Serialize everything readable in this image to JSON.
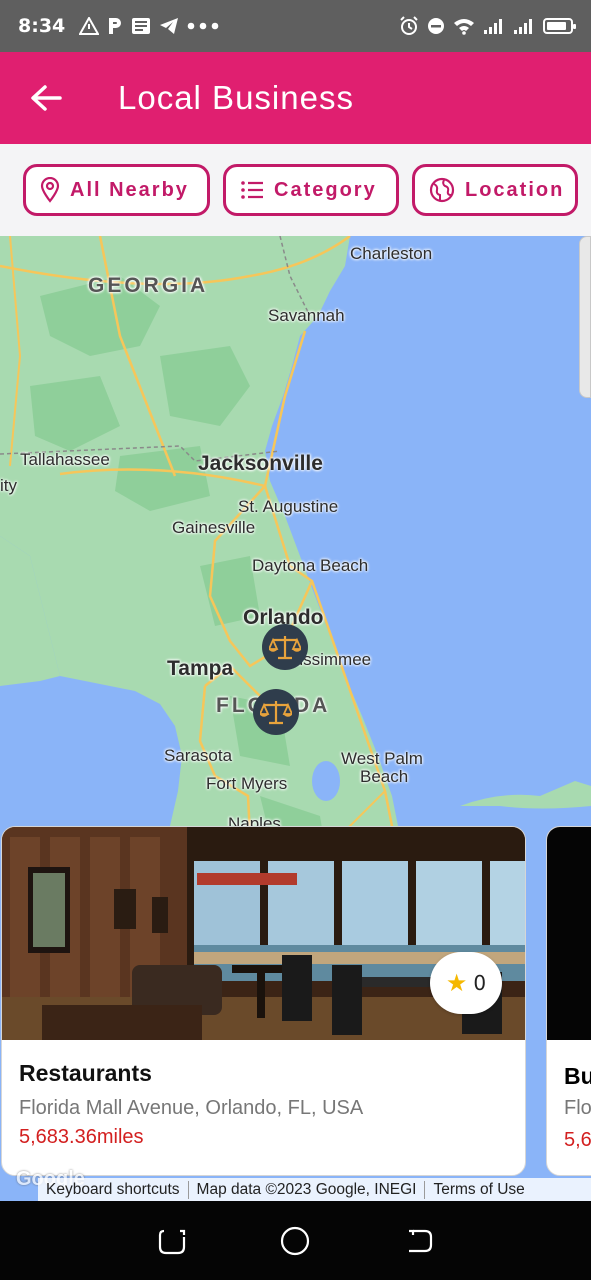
{
  "status_bar": {
    "time": "8:34",
    "left_icons": [
      "warning-icon",
      "p-icon",
      "news-icon",
      "telegram-icon",
      "more-dots-icon"
    ],
    "right_icons": [
      "alarm-icon",
      "dnd-icon",
      "wifi-icon",
      "signal-icon",
      "signal-icon",
      "battery-icon"
    ],
    "battery_level": 0.85
  },
  "app_bar": {
    "title": "Local Business",
    "back_icon": "arrow-left-icon"
  },
  "filters": [
    {
      "label": "All Nearby",
      "icon": "map-pin-icon"
    },
    {
      "label": "Category",
      "icon": "list-icon"
    },
    {
      "label": "Location",
      "icon": "globe-icon"
    }
  ],
  "map": {
    "labels": {
      "georgia": "GEORGIA",
      "charleston": "Charleston",
      "savannah": "Savannah",
      "tallahassee": "Tallahassee",
      "jacksonville": "Jacksonville",
      "st_augustine": "St. Augustine",
      "gainesville": "Gainesville",
      "daytona": "Daytona Beach",
      "orlando": "Orlando",
      "kissimmee": "Kissimmee",
      "tampa": "Tampa",
      "florida": "FLORIDA",
      "sarasota": "Sarasota",
      "fort_myers": "Fort Myers",
      "west_palm": "West Palm",
      "west_palm_2": "Beach",
      "naples": "Naples",
      "ity": "ity"
    },
    "marker_icon": "scales-icon",
    "attribution": {
      "keyboard": "Keyboard shortcuts",
      "map_data": "Map data ©2023 Google, INEGI",
      "terms": "Terms of Use"
    },
    "google_logo": "Google"
  },
  "cards": [
    {
      "title": "Restaurants",
      "address": "Florida Mall Avenue, Orlando, FL, USA",
      "distance": "5,683.36miles",
      "rating": "0"
    },
    {
      "title": "Bu",
      "address": "Flo",
      "distance": "5,6"
    }
  ],
  "nav_bar": {
    "icons": [
      "recent-apps-icon",
      "home-icon",
      "back-icon"
    ]
  },
  "colors": {
    "brand": "#e01f70",
    "chip_border": "#c21a68",
    "distance": "#d32020"
  }
}
